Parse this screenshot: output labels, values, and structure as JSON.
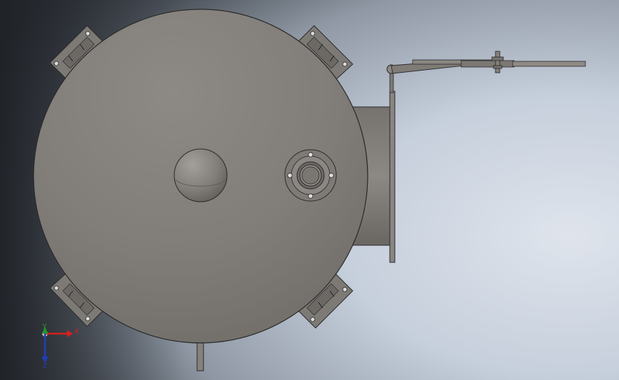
{
  "viewport": {
    "background_colors": [
      "#24272d",
      "#7f8894",
      "#c7d0dd",
      "#dfe4ec"
    ]
  },
  "model": {
    "body_color": "#8a8783",
    "edge_color": "#2a2a2a",
    "bracket_color": "#7b7874"
  },
  "triad": {
    "x_label": "X",
    "y_label": "Y",
    "z_label": "Z",
    "x_color": "#d42020",
    "y_color": "#1f9a2a",
    "z_color": "#1e3fb6"
  }
}
